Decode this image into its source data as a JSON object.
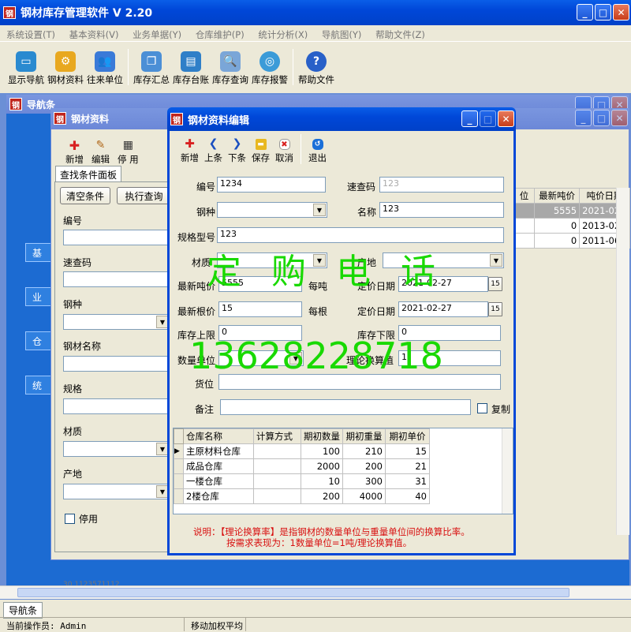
{
  "app": {
    "title": "钢材库存管理软件 V 2.20",
    "icon_text": "钢"
  },
  "menu": [
    "系统设置(T)",
    "基本资料(V)",
    "业务单据(Y)",
    "仓库维护(P)",
    "统计分析(X)",
    "导航图(Y)",
    "帮助文件(Z)"
  ],
  "toolbar": [
    "显示导航",
    "钢材资料",
    "往来单位",
    "库存汇总",
    "库存台账",
    "库存查询",
    "库存报警",
    "帮助文件"
  ],
  "nav_window": {
    "title": "导航条"
  },
  "steel_window": {
    "title": "钢材资料",
    "toolbar": [
      "新增",
      "编辑",
      "停 用"
    ],
    "tab": "查找条件面板",
    "clear_btn": "清空条件",
    "query_btn": "执行查询",
    "labels": {
      "code": "编号",
      "quick": "速查码",
      "kind": "钢种",
      "name": "钢材名称",
      "spec": "规格",
      "material": "材质",
      "origin": "产地",
      "disable": "停用"
    }
  },
  "bg_grid": {
    "headers": [
      "位",
      "最新吨价",
      "吨价日期"
    ],
    "rows": [
      [
        "",
        "5555",
        "2021-02-"
      ],
      [
        "",
        "0",
        "2013-02-"
      ],
      [
        "",
        "0",
        "2011-06-"
      ]
    ]
  },
  "edit_dialog": {
    "title": "钢材资料编辑",
    "toolbar": [
      "新增",
      "上条",
      "下条",
      "保存",
      "取消",
      "退出"
    ],
    "labels": {
      "code": "编号",
      "quick": "速查码",
      "kind": "钢种",
      "name": "名称",
      "spec": "规格型号",
      "material": "材质",
      "origin": "产地",
      "ton_price": "最新吨价",
      "per_ton": "每吨",
      "price_date1": "定价日期",
      "root_price": "最新根价",
      "per_root": "每根",
      "price_date2": "定价日期",
      "stock_upper": "库存上限",
      "stock_lower": "库存下限",
      "qty_unit": "数量单位",
      "conv": "理论换算值",
      "location": "货位",
      "remark": "备注",
      "copy": "复制"
    },
    "values": {
      "code": "1234",
      "quick": "123",
      "name": "123",
      "spec": "123",
      "ton_price": "5555",
      "price_date1": "2021-02-27",
      "root_price": "15",
      "price_date2": "2021-02-27",
      "stock_upper": "0",
      "stock_lower": "0",
      "conv": "1"
    },
    "grid": {
      "headers": [
        "仓库名称",
        "计算方式",
        "期初数量",
        "期初重量",
        "期初单价"
      ],
      "rows": [
        [
          "主原材料仓库",
          "",
          "100",
          "210",
          "15"
        ],
        [
          "成品仓库",
          "",
          "2000",
          "200",
          "21"
        ],
        [
          "一楼仓库",
          "",
          "10",
          "300",
          "31"
        ],
        [
          "2楼仓库",
          "",
          "200",
          "4000",
          "40"
        ]
      ]
    },
    "note1": "说明：【理论换算率】是指钢材的数量单位与重量单位间的换算比率。",
    "note2": "按需求表现为：1数量单位=1吨/理论换算值。"
  },
  "watermark": {
    "line1": "定 购 电 话",
    "line2": "13628228718"
  },
  "navbar_tab": "导航条",
  "status": {
    "operator": "当前操作员: Admin",
    "method": "移动加权平均"
  },
  "bg_text": "30 1123571112",
  "nav_buttons": [
    "基",
    "业",
    "仓",
    "统"
  ]
}
